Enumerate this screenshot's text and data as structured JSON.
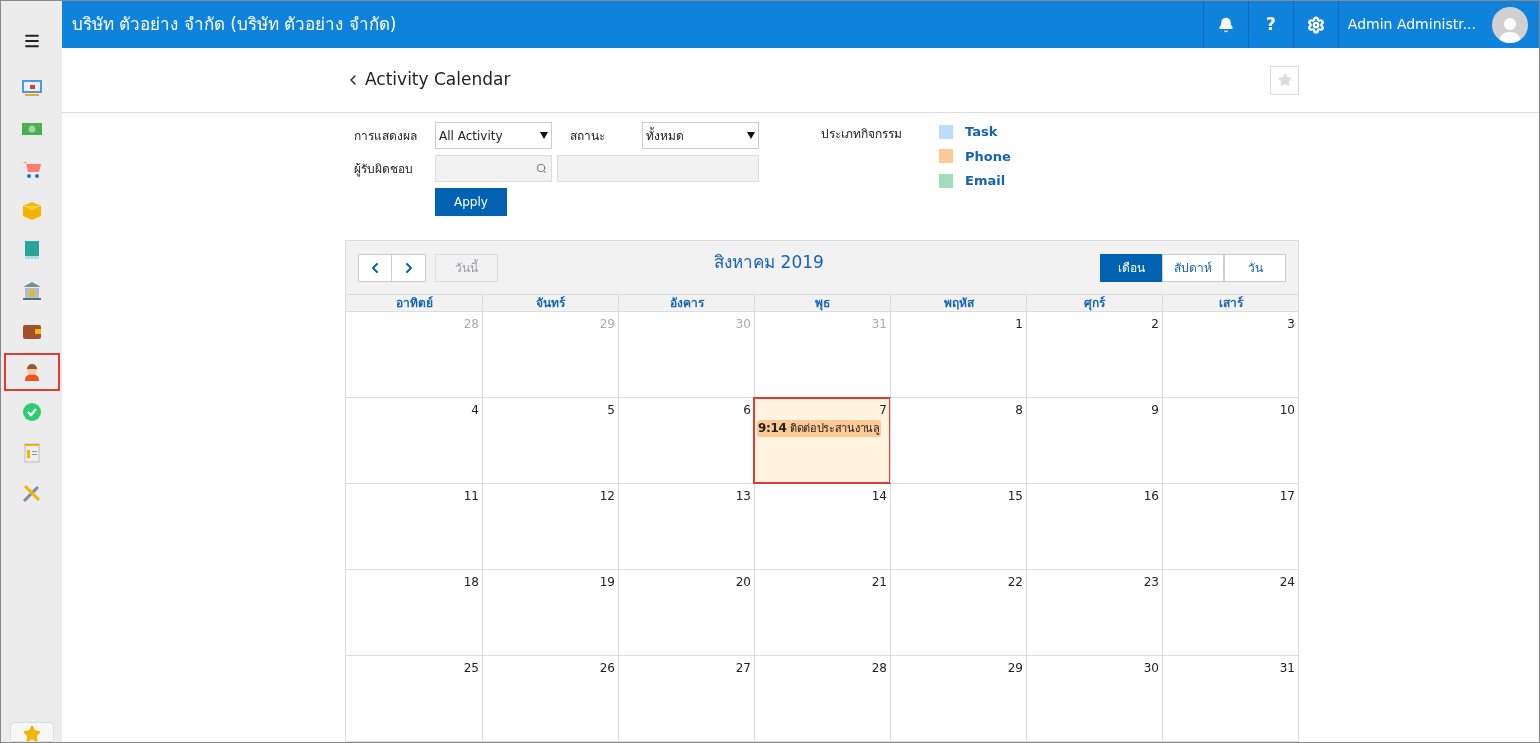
{
  "header": {
    "company": "บริษัท ตัวอย่าง จำกัด (บริษัท ตัวอย่าง จำกัด)",
    "user": "Admin Administr...",
    "help": "?"
  },
  "sidebar": {
    "items": [
      {
        "kind": "monitor",
        "selected": false
      },
      {
        "kind": "money",
        "selected": false
      },
      {
        "kind": "cart",
        "selected": false
      },
      {
        "kind": "box",
        "selected": false
      },
      {
        "kind": "book",
        "selected": false
      },
      {
        "kind": "bank",
        "selected": false
      },
      {
        "kind": "wallet",
        "selected": false
      },
      {
        "kind": "person",
        "selected": true
      },
      {
        "kind": "check",
        "selected": false
      },
      {
        "kind": "invoice",
        "selected": false
      },
      {
        "kind": "tools",
        "selected": false
      }
    ]
  },
  "page": {
    "title": "Activity Calendar"
  },
  "filters": {
    "display_label": "การแสดงผล",
    "display_value": "All Activity",
    "status_label": "สถานะ",
    "status_value": "ทั้งหมด",
    "owner_label": "ผู้รับผิดชอบ",
    "apply": "Apply",
    "type_label": "ประเภทกิจกรรม",
    "types": [
      {
        "label": "Task",
        "color": "#bcdcfb"
      },
      {
        "label": "Phone",
        "color": "#fdca96"
      },
      {
        "label": "Email",
        "color": "#a0dcbc"
      }
    ]
  },
  "calendar": {
    "today": "วันนี้",
    "title": "สิงหาคม 2019",
    "views": [
      {
        "label": "เดือน",
        "selected": true
      },
      {
        "label": "สัปดาห์",
        "selected": false
      },
      {
        "label": "วัน",
        "selected": false
      }
    ],
    "weekdays": [
      "อาทิตย์",
      "จันทร์",
      "อังคาร",
      "พุธ",
      "พฤหัส",
      "ศุกร์",
      "เสาร์"
    ],
    "days": [
      {
        "day": "28",
        "muted": true
      },
      {
        "day": "29",
        "muted": true
      },
      {
        "day": "30",
        "muted": true
      },
      {
        "day": "31",
        "muted": true
      },
      {
        "day": "1",
        "muted": false
      },
      {
        "day": "2",
        "muted": false
      },
      {
        "day": "3",
        "muted": false
      },
      {
        "day": "4",
        "muted": false
      },
      {
        "day": "5",
        "muted": false
      },
      {
        "day": "6",
        "muted": false
      },
      {
        "day": "7",
        "muted": false,
        "selected": true,
        "events": [
          {
            "time": "9:14",
            "title": "ติดต่อประสานงานลู",
            "color": "#fdca96"
          }
        ]
      },
      {
        "day": "8",
        "muted": false
      },
      {
        "day": "9",
        "muted": false
      },
      {
        "day": "10",
        "muted": false
      },
      {
        "day": "11",
        "muted": false
      },
      {
        "day": "12",
        "muted": false
      },
      {
        "day": "13",
        "muted": false
      },
      {
        "day": "14",
        "muted": false
      },
      {
        "day": "15",
        "muted": false
      },
      {
        "day": "16",
        "muted": false
      },
      {
        "day": "17",
        "muted": false
      },
      {
        "day": "18",
        "muted": false
      },
      {
        "day": "19",
        "muted": false
      },
      {
        "day": "20",
        "muted": false
      },
      {
        "day": "21",
        "muted": false
      },
      {
        "day": "22",
        "muted": false
      },
      {
        "day": "23",
        "muted": false
      },
      {
        "day": "24",
        "muted": false
      },
      {
        "day": "25",
        "muted": false
      },
      {
        "day": "26",
        "muted": false
      },
      {
        "day": "27",
        "muted": false
      },
      {
        "day": "28",
        "muted": false
      },
      {
        "day": "29",
        "muted": false
      },
      {
        "day": "30",
        "muted": false
      },
      {
        "day": "31",
        "muted": false
      }
    ]
  }
}
